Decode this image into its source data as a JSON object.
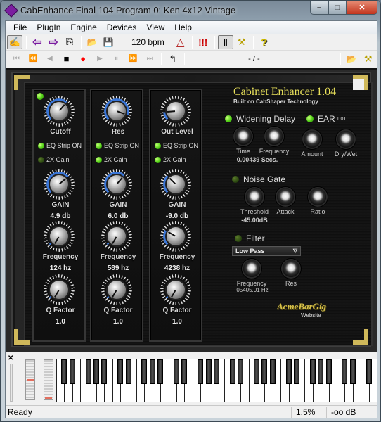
{
  "window": {
    "title": "CabEnhance Final 104 Program 0: Ken 4x12 Vintage",
    "buttons": {
      "minimize": "–",
      "maximize": "□",
      "close": "✕"
    }
  },
  "menu": [
    "File",
    "PlugIn",
    "Engine",
    "Devices",
    "View",
    "Help"
  ],
  "toolbar": {
    "bpm": "120 bpm",
    "icons": {
      "patch": "✍",
      "back": "⇦",
      "forward": "⇨",
      "copy": "⎘",
      "open": "📂",
      "save": "💾",
      "metronome": "△",
      "panic": "!!!",
      "keyboard": "‖",
      "settings": "⚒",
      "help": "?"
    }
  },
  "transport": {
    "buttons": [
      "⏮",
      "⏪",
      "◀",
      "■",
      "●",
      "▶",
      "⏸",
      "⏩",
      "⏭"
    ],
    "loop": "↰",
    "position": "- / -",
    "open": "📂",
    "settings": "⚒"
  },
  "plugin": {
    "title": "Cabinet Enhancer 1.04",
    "subtitle": "Built on CabShaper Technology",
    "strips": [
      {
        "top_label": "Cutoff",
        "eq_strip": "EQ Strip ON",
        "gain2x": "2X Gain",
        "gain2x_on": false,
        "gain_label": "GAIN",
        "gain_value": "4.9 db",
        "freq_label": "Frequency",
        "freq_value": "124 hz",
        "q_label": "Q Factor",
        "q_value": "1.0"
      },
      {
        "top_label": "Res",
        "eq_strip": "EQ Strip ON",
        "gain2x": "2X Gain",
        "gain2x_on": true,
        "gain_label": "GAIN",
        "gain_value": "6.0 db",
        "freq_label": "Frequency",
        "freq_value": "589 hz",
        "q_label": "Q Factor",
        "q_value": "1.0"
      },
      {
        "top_label": "Out Level",
        "eq_strip": "EQ Strip ON",
        "gain2x": "2X Gain",
        "gain2x_on": true,
        "gain_label": "GAIN",
        "gain_value": "-9.0 db",
        "freq_label": "Frequency",
        "freq_value": "4238 hz",
        "q_label": "Q Factor",
        "q_value": "1.0"
      }
    ],
    "widening": {
      "title": "Widening Delay",
      "time": "Time",
      "frequency": "Frequency",
      "time_value": "0.00439 Secs."
    },
    "ear": {
      "title": "EAR",
      "version": "1.01",
      "amount": "Amount",
      "drywet": "Dry/Wet"
    },
    "noise_gate": {
      "title": "Noise Gate",
      "threshold": "Threshold",
      "attack": "Attack",
      "ratio": "Ratio",
      "threshold_value": "-45.00dB"
    },
    "filter": {
      "title": "Filter",
      "type": "Low Pass",
      "frequency": "Frequency",
      "res": "Res",
      "frequency_value": "05405.01 Hz"
    },
    "brand": {
      "name": "AcmeBarGig",
      "link": "Website"
    }
  },
  "keyboard": {
    "close": "✕"
  },
  "status": {
    "text": "Ready",
    "cpu": "1.5%",
    "level": "-oo dB"
  }
}
